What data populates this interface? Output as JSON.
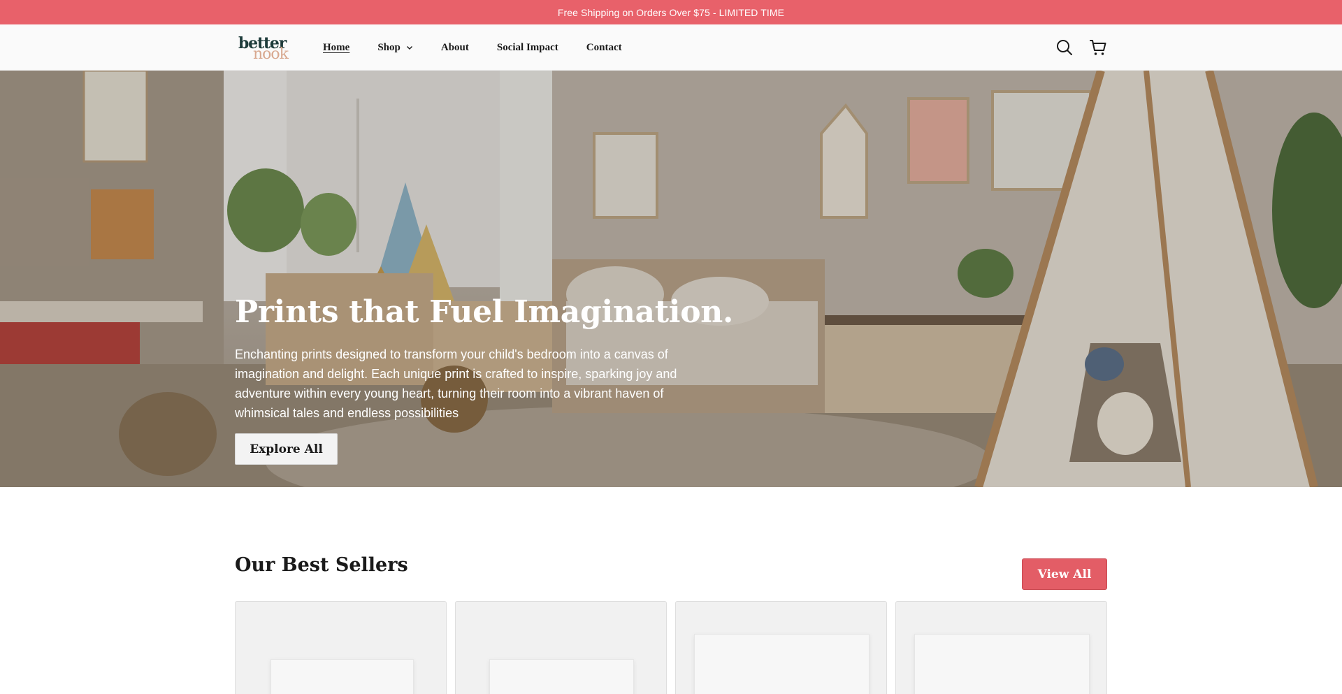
{
  "announcement": {
    "text": "Free Shipping on Orders Over $75 - LIMITED TIME"
  },
  "brand": {
    "logo_line1": "better",
    "logo_line2": "nook"
  },
  "nav": {
    "items": [
      {
        "label": "Home",
        "active": true
      },
      {
        "label": "Shop",
        "has_dropdown": true
      },
      {
        "label": "About"
      },
      {
        "label": "Social Impact"
      },
      {
        "label": "Contact"
      }
    ]
  },
  "header_icons": [
    "search-icon",
    "cart-icon"
  ],
  "hero": {
    "title": "Prints that Fuel Imagination.",
    "description": "Enchanting prints designed to transform your child's bedroom into a canvas of imagination and delight. Each unique print is crafted to inspire, sparking joy and adventure within every young heart, turning their room into a vibrant haven of whimsical tales and endless possibilities",
    "button_label": "Explore All"
  },
  "best_sellers": {
    "title": "Our Best Sellers",
    "view_all_label": "View All",
    "product_count_visible": 4
  },
  "colors": {
    "accent": "#e8616a",
    "button_red": "#e35d66",
    "logo_dark": "#1d3b3a",
    "logo_light": "#d8a88f"
  }
}
